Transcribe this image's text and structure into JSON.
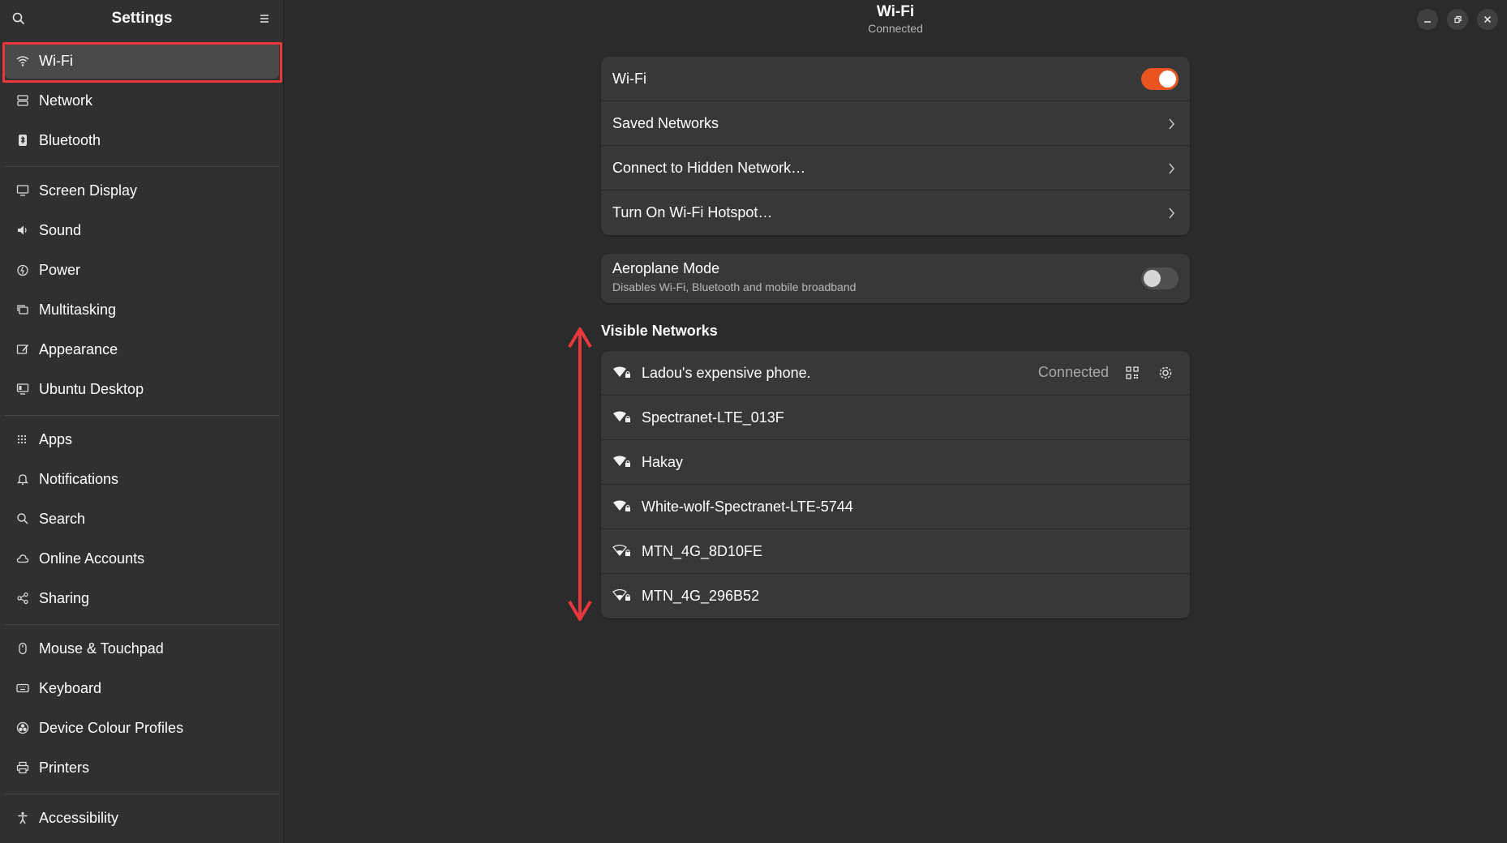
{
  "sidebar": {
    "title": "Settings",
    "search_icon": "search-icon",
    "menu_icon": "hamburger-menu-icon",
    "items": [
      {
        "label": "Wi-Fi",
        "icon": "wifi-icon"
      },
      {
        "label": "Network",
        "icon": "network-icon"
      },
      {
        "label": "Bluetooth",
        "icon": "bluetooth-icon"
      },
      {
        "label": "Screen Display",
        "icon": "display-icon"
      },
      {
        "label": "Sound",
        "icon": "speaker-icon"
      },
      {
        "label": "Power",
        "icon": "power-icon"
      },
      {
        "label": "Multitasking",
        "icon": "multitasking-icon"
      },
      {
        "label": "Appearance",
        "icon": "appearance-icon"
      },
      {
        "label": "Ubuntu Desktop",
        "icon": "desktop-icon"
      },
      {
        "label": "Apps",
        "icon": "apps-grid-icon"
      },
      {
        "label": "Notifications",
        "icon": "bell-icon"
      },
      {
        "label": "Search",
        "icon": "search-icon"
      },
      {
        "label": "Online Accounts",
        "icon": "cloud-icon"
      },
      {
        "label": "Sharing",
        "icon": "share-icon"
      },
      {
        "label": "Mouse & Touchpad",
        "icon": "mouse-icon"
      },
      {
        "label": "Keyboard",
        "icon": "keyboard-icon"
      },
      {
        "label": "Device Colour Profiles",
        "icon": "color-profile-icon"
      },
      {
        "label": "Printers",
        "icon": "printer-icon"
      },
      {
        "label": "Accessibility",
        "icon": "accessibility-icon"
      }
    ]
  },
  "header": {
    "title": "Wi-Fi",
    "subtitle": "Connected"
  },
  "wifi_card": {
    "wifi_label": "Wi-Fi",
    "wifi_enabled": true,
    "saved_networks": "Saved Networks",
    "hidden_network": "Connect to Hidden Network…",
    "hotspot": "Turn On Wi-Fi Hotspot…"
  },
  "aeroplane": {
    "label": "Aeroplane Mode",
    "description": "Disables Wi-Fi, Bluetooth and mobile broadband",
    "enabled": false
  },
  "visible_networks": {
    "title": "Visible Networks",
    "networks": [
      {
        "name": "Ladou's expensive phone.",
        "status": "Connected"
      },
      {
        "name": "Spectranet-LTE_013F"
      },
      {
        "name": "Hakay"
      },
      {
        "name": "White-wolf-Spectranet-LTE-5744"
      },
      {
        "name": "MTN_4G_8D10FE"
      },
      {
        "name": "MTN_4G_296B52"
      }
    ]
  },
  "colors": {
    "accent": "#e95420",
    "annotation": "#e8383d",
    "background": "#2b2b2b",
    "sidebar": "#303030",
    "card": "#383838"
  }
}
